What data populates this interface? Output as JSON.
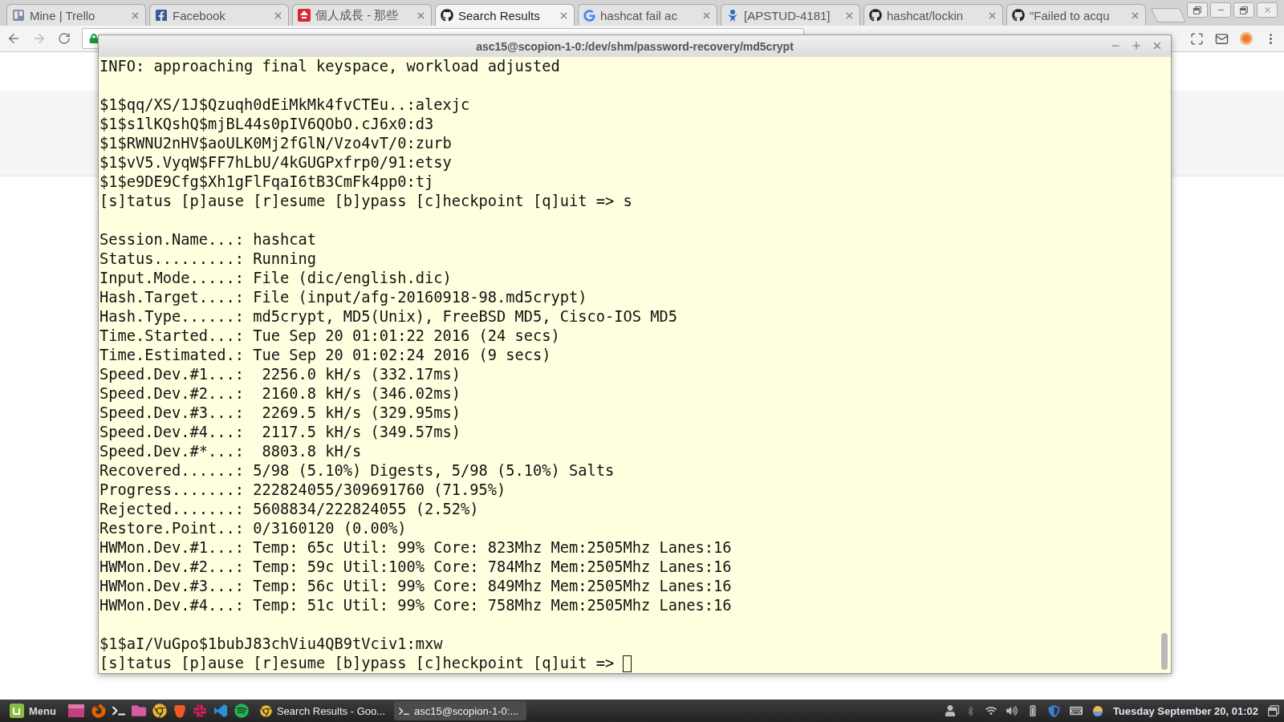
{
  "browser": {
    "tabs": [
      {
        "title": "Mine | Trello",
        "selected": false
      },
      {
        "title": "Facebook",
        "selected": false
      },
      {
        "title": "個人成長 - 那些",
        "selected": false
      },
      {
        "title": "Search Results",
        "selected": true
      },
      {
        "title": "hashcat fail ac",
        "selected": false
      },
      {
        "title": "[APSTUD-4181]",
        "selected": false
      },
      {
        "title": "hashcat/lockin",
        "selected": false
      },
      {
        "title": "\"Failed to acqu",
        "selected": false
      }
    ]
  },
  "terminal": {
    "title": "asc15@scopion-1-0:/dev/shm/password-recovery/md5crypt",
    "lines": [
      {
        "kind": "text",
        "text": "INFO: approaching final keyspace, workload adjusted"
      },
      {
        "kind": "blank"
      },
      {
        "kind": "text",
        "text": "$1$qq/XS/1J$Qzuqh0dEiMkMk4fvCTEu..:alexjc"
      },
      {
        "kind": "text",
        "text": "$1$s1lKQshQ$mjBL44s0pIV6QObO.cJ6x0:d3"
      },
      {
        "kind": "text",
        "text": "$1$RWNU2nHV$aoULK0Mj2fGlN/Vzo4vT/0:zurb"
      },
      {
        "kind": "text",
        "text": "$1$vV5.VyqW$FF7hLbU/4kGUGPxfrp0/91:etsy"
      },
      {
        "kind": "text",
        "text": "$1$e9DE9Cfg$Xh1gFlFqaI6tB3CmFk4pp0:tj"
      },
      {
        "kind": "text",
        "text": "[s]tatus [p]ause [r]esume [b]ypass [c]heckpoint [q]uit => s"
      },
      {
        "kind": "blank"
      },
      {
        "kind": "text",
        "text": "Session.Name...: hashcat"
      },
      {
        "kind": "text",
        "text": "Status.........: Running"
      },
      {
        "kind": "text",
        "text": "Input.Mode.....: File (dic/english.dic)"
      },
      {
        "kind": "text",
        "text": "Hash.Target....: File (input/afg-20160918-98.md5crypt)"
      },
      {
        "kind": "text",
        "text": "Hash.Type......: md5crypt, MD5(Unix), FreeBSD MD5, Cisco-IOS MD5"
      },
      {
        "kind": "text",
        "text": "Time.Started...: Tue Sep 20 01:01:22 2016 (24 secs)"
      },
      {
        "kind": "text",
        "text": "Time.Estimated.: Tue Sep 20 01:02:24 2016 (9 secs)"
      },
      {
        "kind": "text",
        "text": "Speed.Dev.#1...:  2256.0 kH/s (332.17ms)"
      },
      {
        "kind": "text",
        "text": "Speed.Dev.#2...:  2160.8 kH/s (346.02ms)"
      },
      {
        "kind": "text",
        "text": "Speed.Dev.#3...:  2269.5 kH/s (329.95ms)"
      },
      {
        "kind": "text",
        "text": "Speed.Dev.#4...:  2117.5 kH/s (349.57ms)"
      },
      {
        "kind": "text",
        "text": "Speed.Dev.#*...:  8803.8 kH/s"
      },
      {
        "kind": "text",
        "text": "Recovered......: 5/98 (5.10%) Digests, 5/98 (5.10%) Salts"
      },
      {
        "kind": "text",
        "text": "Progress.......: 222824055/309691760 (71.95%)"
      },
      {
        "kind": "text",
        "text": "Rejected.......: 5608834/222824055 (2.52%)"
      },
      {
        "kind": "text",
        "text": "Restore.Point..: 0/3160120 (0.00%)"
      },
      {
        "kind": "text",
        "text": "HWMon.Dev.#1...: Temp: 65c Util: 99% Core: 823Mhz Mem:2505Mhz Lanes:16"
      },
      {
        "kind": "text",
        "text": "HWMon.Dev.#2...: Temp: 59c Util:100% Core: 784Mhz Mem:2505Mhz Lanes:16"
      },
      {
        "kind": "text",
        "text": "HWMon.Dev.#3...: Temp: 56c Util: 99% Core: 849Mhz Mem:2505Mhz Lanes:16"
      },
      {
        "kind": "text",
        "text": "HWMon.Dev.#4...: Temp: 51c Util: 99% Core: 758Mhz Mem:2505Mhz Lanes:16"
      },
      {
        "kind": "blank"
      },
      {
        "kind": "text",
        "text": "$1$aI/VuGpo$1bubJ83chViu4QB9tVciv1:mxw"
      },
      {
        "kind": "prompt",
        "text": "[s]tatus [p]ause [r]esume [b]ypass [c]heckpoint [q]uit =>",
        "cursor": true
      }
    ]
  },
  "taskbar": {
    "menu": "Menu",
    "tasks": [
      {
        "title": "Search Results - Goo...",
        "selected": false
      },
      {
        "title": "asc15@scopion-1-0:...",
        "selected": true
      }
    ],
    "clock": "Tuesday September 20, 01:02"
  }
}
